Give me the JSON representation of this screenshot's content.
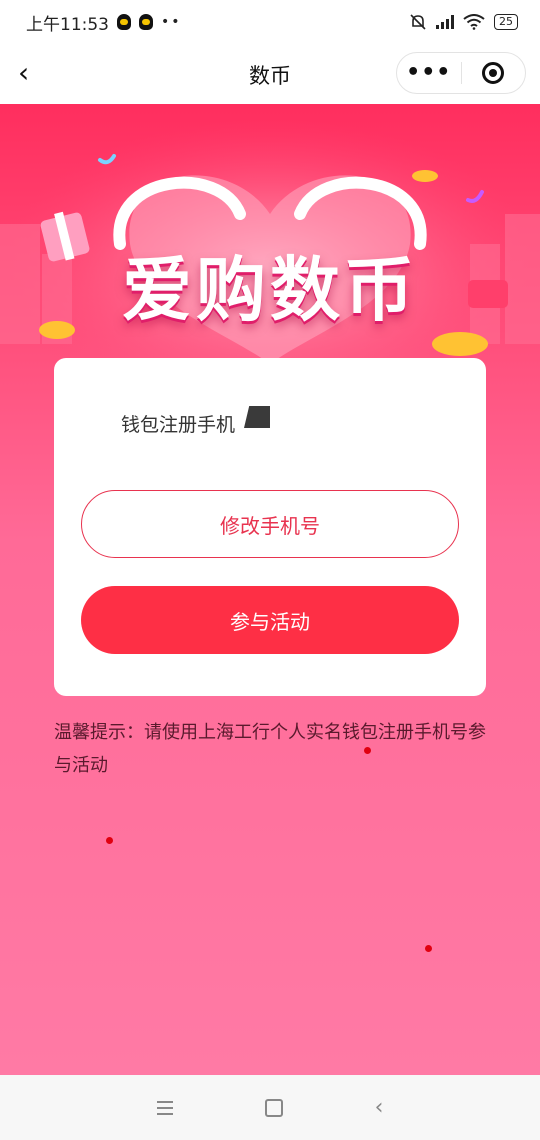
{
  "status_bar": {
    "time": "上午11:53",
    "dots": "••",
    "battery": "25"
  },
  "nav": {
    "title": "数币",
    "more_label": "•••"
  },
  "banner": {
    "title": "爱购数币"
  },
  "card": {
    "phone_label": "钱包注册手机",
    "change_phone_button": "修改手机号",
    "join_button": "参与活动"
  },
  "tip": "温馨提示：请使用上海工行个人实名钱包注册手机号参与活动",
  "colors": {
    "brand_red": "#fe2f45",
    "outline_red": "#e8334f",
    "bg_top": "#ff2e5e",
    "bg_bottom": "#ff7aa5"
  },
  "icons": [
    "back-icon",
    "more-icon",
    "close-mini-program-icon",
    "qq-icon",
    "mute-bell-icon",
    "signal-icon",
    "wifi-icon",
    "battery-icon",
    "menu-icon",
    "home-icon",
    "system-back-icon"
  ]
}
